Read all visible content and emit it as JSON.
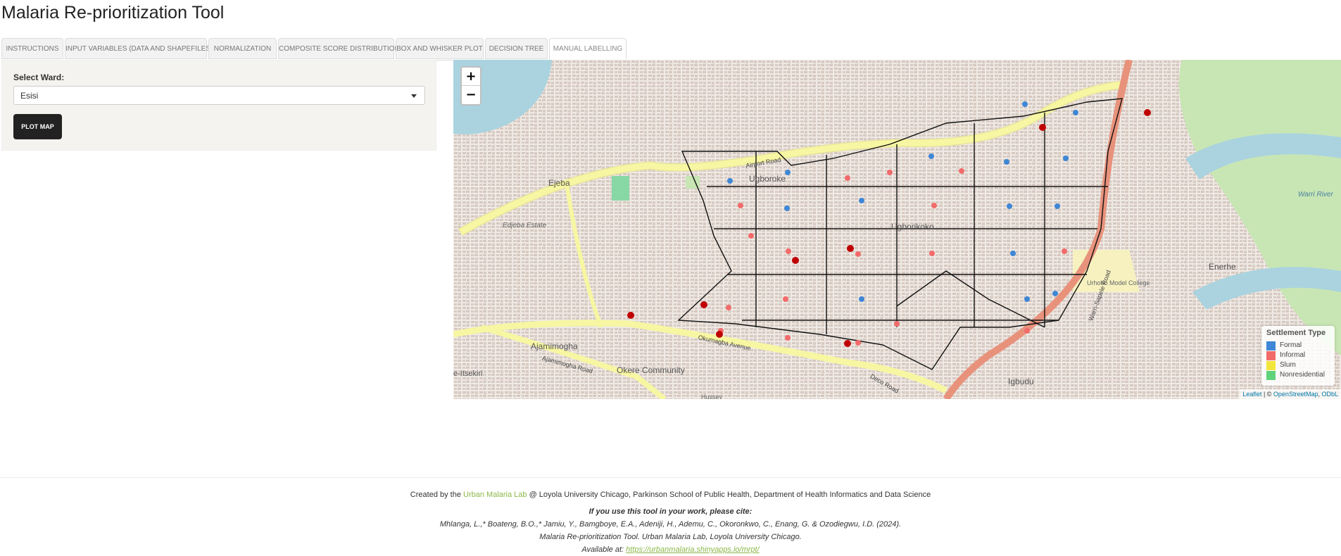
{
  "title": "Malaria Re-prioritization Tool",
  "tabs": [
    {
      "label": "Instructions",
      "active": false
    },
    {
      "label": "Input Variables (Data and Shapefiles)",
      "active": false
    },
    {
      "label": "Normalization",
      "active": false
    },
    {
      "label": "Composite Score Distribution",
      "active": false
    },
    {
      "label": "Box and Whisker Plot",
      "active": false
    },
    {
      "label": "Decision Tree",
      "active": false
    },
    {
      "label": "Manual Labelling",
      "active": true
    }
  ],
  "sidebar": {
    "ward_label": "Select Ward:",
    "ward_value": "Esisi",
    "plot_button": "PLOT MAP"
  },
  "map": {
    "zoom_in": "+",
    "zoom_out": "−",
    "place_labels": {
      "ugboroke": "Ugboroke",
      "ugborikoko": "Ugborikoko",
      "ejeba": "Ejeba",
      "edjeba_estate": "Edjeba Estate",
      "ajamimogha": "Ajamimogha",
      "okere_community": "Okere Community",
      "igbudu": "Igbudu",
      "enerhe": "Enerhe",
      "urhobo_college": "Urhobo Model College",
      "warri_river": "Warri River",
      "e_itsekiri": "e-Itsekiri",
      "hussey": "Hussey"
    },
    "road_labels": {
      "airport_road": "Airport Road",
      "okumagba_avenue": "Okumagba Avenue",
      "ajamimogha_road": "Ajamimogha Road",
      "warri_sapele_road": "Warri-Sapele Road",
      "deco_road": "Deco Road"
    },
    "legend": {
      "title": "Settlement Type",
      "items": [
        {
          "label": "Formal",
          "color": "#3f87d6"
        },
        {
          "label": "Informal",
          "color": "#f26b6b"
        },
        {
          "label": "Slum",
          "color": "#f2e63c"
        },
        {
          "label": "Nonresidential",
          "color": "#5fd37a"
        }
      ]
    },
    "attribution": {
      "leaflet": "Leaflet",
      "sep": " | © ",
      "osm": "OpenStreetMap",
      "sep2": ", ",
      "odbl": "ODbL"
    },
    "colors": {
      "background": "#efeae5",
      "building": "#d6c8c0",
      "major_road": "#f7f6a2",
      "trunk_road": "#e8927c",
      "water": "#aad3df",
      "park": "#c8e6b4",
      "grid_line": "#111111",
      "hospital": "#c00000"
    }
  },
  "footer": {
    "created_prefix": "Created by the ",
    "lab_name": "Urban Malaria Lab",
    "created_suffix": " @ Loyola University Chicago, Parkinson School of Public Health, Department of Health Informatics and Data Science",
    "cite_heading": "If you use this tool in your work, please cite:",
    "cite_authors": "Mhlanga, L.,* Boateng, B.O.,* Jamiu, Y., Bamgboye, E.A., Adeniji, H., Ademu, C., Okoronkwo, C., Enang, G. & Ozodiegwu, I.D. (2024).",
    "cite_title": "Malaria Re-prioritization Tool. Urban Malaria Lab, Loyola University Chicago.",
    "available_prefix": "Available at: ",
    "url": "https://urbanmalaria.shinyapps.io/mrpt/"
  }
}
